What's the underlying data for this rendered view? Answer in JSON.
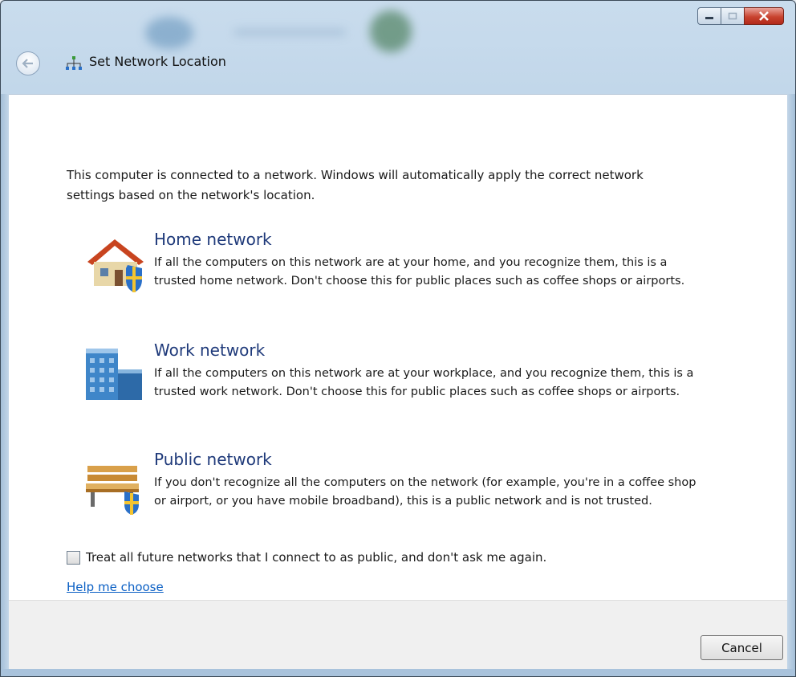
{
  "window": {
    "title": "Set Network Location"
  },
  "intro_text": "This computer is connected to a network. Windows will automatically apply the correct network settings based on the network's location.",
  "options": [
    {
      "title": "Home network",
      "description": "If all the computers on this network are at your home, and you recognize them, this is a trusted home network.  Don't choose this for public places such as coffee shops or airports.",
      "icon": "home-network-icon"
    },
    {
      "title": "Work network",
      "description": "If all the computers on this network are at your workplace, and you recognize them, this is a trusted work network.  Don't choose this for public places such as coffee shops or airports.",
      "icon": "work-network-icon"
    },
    {
      "title": "Public network",
      "description": "If you don't recognize all the computers on the network (for example, you're in a coffee shop or airport, or you have mobile broadband), this is a public network and is not trusted.",
      "icon": "public-network-icon"
    }
  ],
  "future_checkbox": {
    "label": "Treat all future networks that I connect to as public, and don't ask me again.",
    "checked": false
  },
  "help_link": "Help me choose",
  "cancel_label": "Cancel",
  "colors": {
    "option_title": "#1f3a7a",
    "link": "#0a5fc4",
    "close_button": "#c8432f"
  }
}
